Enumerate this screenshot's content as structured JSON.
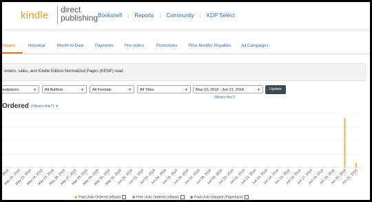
{
  "header": {
    "logo_kindle": "kindle",
    "logo_dp_line1": "direct",
    "logo_dp_line2": "publishing",
    "nav": [
      "Bookshelf",
      "Reports",
      "Community",
      "KDP Select"
    ]
  },
  "tabs": [
    {
      "label": "hboard",
      "active": true
    },
    {
      "label": "Historical",
      "active": false
    },
    {
      "label": "Month-to-Date",
      "active": false
    },
    {
      "label": "Payments",
      "active": false
    },
    {
      "label": "Pre-orders",
      "active": false
    },
    {
      "label": "Promotions",
      "active": false
    },
    {
      "label": "Prior Months' Royalties",
      "active": false
    },
    {
      "label": "Ad Campaigns",
      "active": false
    }
  ],
  "info_text": "orders, sales, and Kindle Edition Normalized Pages (KENP) read.",
  "filters": {
    "marketplace": "ketplaces",
    "authors": "All Authors",
    "formats": "All Formats",
    "titles": "All Titles",
    "date_range": "May 22, 2018 - Jun 21, 2018",
    "update_label": "Update",
    "whats_this": "(What's this?)"
  },
  "chart_title": "Ordered",
  "chart_help": "(What's this?)",
  "legend": [
    {
      "label": "Paid Units Ordered (eBook)",
      "color": "#f5b041"
    },
    {
      "label": "Free Units Ordered (eBook)",
      "color": "#5dade2"
    },
    {
      "label": "Paid Units Shipped (Paperback)",
      "color": "#7f8c8d"
    }
  ],
  "colors": {
    "accent": "#e8731b",
    "link": "#2b6cb0",
    "bar": "#f5b041"
  },
  "chart_data": {
    "type": "bar",
    "categories": [
      "May 21, 2018",
      "May 22, 2018",
      "May 23, 2018",
      "May 24, 2018",
      "May 25, 2018",
      "May 26, 2018",
      "May 27, 2018",
      "May 28, 2018",
      "May 29, 2018",
      "May 30, 2018",
      "May 31, 2018",
      "Jun 01, 2018",
      "Jun 02, 2018",
      "Jun 03, 2018",
      "Jun 04, 2018",
      "Jun 05, 2018",
      "Jun 06, 2018",
      "Jun 07, 2018",
      "Jun 08, 2018",
      "Jun 09, 2018",
      "Jun 10, 2018",
      "Jun 11, 2018",
      "Jun 12, 2018",
      "Jun 13, 2018",
      "Jun 14, 2018",
      "Jun 15, 2018",
      "Jun 16, 2018",
      "Jun 17, 2018",
      "Jun 18, 2018",
      "Jun 19, 2018",
      "Jun 20, 2018",
      "Jun 21, 2018"
    ],
    "series": [
      {
        "name": "Paid Units Ordered (eBook)",
        "color": "#f5b041",
        "values": [
          0,
          0,
          0,
          0,
          0,
          0,
          0,
          0,
          0,
          0,
          0,
          0,
          0,
          0,
          0,
          0,
          0,
          0,
          0,
          0,
          0,
          0,
          0,
          0,
          0,
          0,
          0,
          0,
          0,
          0,
          10,
          1
        ]
      }
    ],
    "ylim": [
      0,
      11
    ],
    "grid": true,
    "legend_position": "bottom"
  }
}
